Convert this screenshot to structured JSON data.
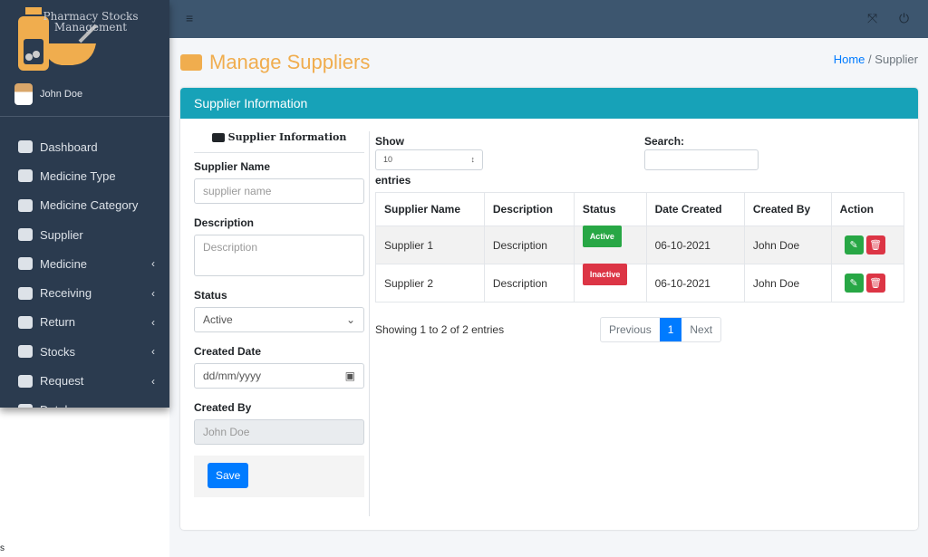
{
  "sidebar": {
    "logo_text": "Pharmacy Stocks Management",
    "user": "John Doe",
    "items": [
      {
        "label": "Dashboard",
        "icon": "home-icon"
      },
      {
        "label": "Medicine Type",
        "icon": "pills-icon"
      },
      {
        "label": "Medicine Category",
        "icon": "capsules-icon"
      },
      {
        "label": "Supplier",
        "icon": "truck-icon"
      },
      {
        "label": "Medicine",
        "icon": "medicine-icon",
        "chevron": "‹"
      },
      {
        "label": "Receiving",
        "icon": "arrow-right-circle-icon",
        "chevron": "‹"
      },
      {
        "label": "Return",
        "icon": "arrow-left-circle-icon",
        "chevron": "‹"
      },
      {
        "label": "Stocks",
        "icon": "layers-icon",
        "chevron": "‹"
      },
      {
        "label": "Request",
        "icon": "prescription-icon",
        "chevron": "‹"
      },
      {
        "label": "Database",
        "icon": "database-icon"
      }
    ]
  },
  "topbar": {
    "menu": "≡",
    "fullscreen": "⤧",
    "power": "⏻"
  },
  "page": {
    "title": "Manage Suppliers",
    "breadcrumb_home": "Home",
    "breadcrumb_sep": "/",
    "breadcrumb_current": "Supplier"
  },
  "card": {
    "title": "Supplier Information"
  },
  "form": {
    "heading": "Supplier Information",
    "name_label": "Supplier Name",
    "name_placeholder": "supplier name",
    "desc_label": "Description",
    "desc_placeholder": "Description",
    "status_label": "Status",
    "status_value": "Active",
    "date_label": "Created Date",
    "date_placeholder": "dd/mm/yyyy",
    "by_label": "Created By",
    "by_value": "John Doe",
    "save": "Save"
  },
  "table": {
    "show": "Show",
    "length": "10",
    "entries": "entries",
    "search": "Search:",
    "headers": [
      "Supplier Name",
      "Description",
      "Status",
      "Date Created",
      "Created By",
      "Action"
    ],
    "rows": [
      {
        "name": "Supplier 1",
        "desc": "Description",
        "status": "Active",
        "date": "06-10-2021",
        "by": "John Doe"
      },
      {
        "name": "Supplier 2",
        "desc": "Description",
        "status": "Inactive",
        "date": "06-10-2021",
        "by": "John Doe"
      }
    ],
    "info": "Showing 1 to 2 of 2 entries",
    "prev": "Previous",
    "page": "1",
    "next": "Next"
  },
  "colors": {
    "active": "#28a745",
    "inactive": "#dc3545",
    "accent": "#f0ad4e",
    "header": "#17a2b8"
  },
  "stray": "s"
}
